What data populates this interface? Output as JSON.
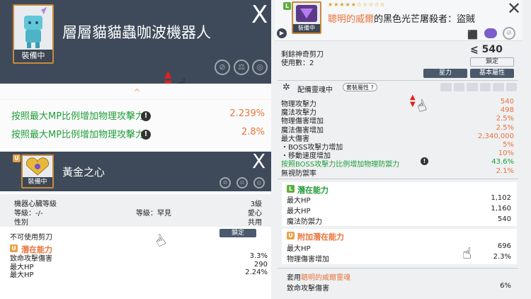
{
  "panel1": {
    "item_name": "層層貓貓蟲咖波機器人",
    "equip_tag": "裝備中",
    "close": "X",
    "stats": [
      {
        "label": "按照最大MP比例增加物理攻擊力",
        "value": "2.239%"
      },
      {
        "label": "按照最大MP比例增加物理攻擊力",
        "value": "2.8%"
      }
    ],
    "warn_glyph": "!"
  },
  "panel2": {
    "grade": "U",
    "item_name": "黃金之心",
    "equip_tag": "裝備中",
    "close": "X",
    "heart_level_label": "機器心臟等級",
    "heart_level_value": "3級",
    "level_label": "等級：-/-",
    "rank_label": "等級：罕見",
    "rank_value": "愛心",
    "gender_label": "性別",
    "gender_value": "共用",
    "scissors_label": "不可使用剪刀",
    "lock_button": "鎖定",
    "potential_title": "潛在能力",
    "potential": [
      {
        "label": "致命攻擊傷害",
        "value": "3.3%"
      },
      {
        "label": "最大HP",
        "value": "290"
      },
      {
        "label": "最大HP",
        "value": "2.24%"
      }
    ]
  },
  "panel3": {
    "grade": "L",
    "stars": "★★★★★☆☆☆☆☆",
    "star_count": 4,
    "title_prefix": "聰明的威爾",
    "title_suffix": "的黑色光芒屠殺者：盜賊",
    "equip_tag": "裝備中",
    "scissors_label": "剩餘神奇剪刀",
    "uses_label": "使用數：2",
    "scissors_value": "540",
    "lock_button": "鎖定",
    "star_button": "星力",
    "base_button": "基本屬性",
    "soul_label": "配備靈魂中",
    "set_button": "套裝屬性",
    "stats": [
      {
        "label": "物理攻擊力",
        "value": "540",
        "color": "#e8743b"
      },
      {
        "label": "魔法攻擊力",
        "value": "498",
        "color": "#e8743b"
      },
      {
        "label": "物理傷害增加",
        "value": "2.5%",
        "color": "#e8743b"
      },
      {
        "label": "魔法傷害增加",
        "value": "2.5%",
        "color": "#e8743b"
      },
      {
        "label": "最大傷害",
        "value": "2,340,000",
        "color": "#e8743b"
      },
      {
        "label": "・BOSS攻擊力增加",
        "value": "5%",
        "color": "#e8743b"
      },
      {
        "label": "・移動速度增加",
        "value": "10%",
        "color": "#e8743b"
      },
      {
        "label": "按照BOSS攻擊力比例增加物理防禦力",
        "value": "43.6%",
        "color": "#1f9d3a"
      },
      {
        "label": "無視防禦率",
        "value": "2.1%",
        "color": "#e8743b"
      }
    ],
    "potential_grade": "L",
    "potential_title": "潛在能力",
    "potential": [
      {
        "label": "最大HP",
        "value": "1,102"
      },
      {
        "label": "最大HP",
        "value": "1,160"
      },
      {
        "label": "魔法防禦力",
        "value": "540"
      }
    ],
    "additional_grade": "U",
    "additional_title": "附加潛在能力",
    "additional": [
      {
        "label": "最大HP",
        "value": "696"
      },
      {
        "label": "物理傷害增加",
        "value": "2.3%"
      }
    ],
    "soul_set_label": "套用",
    "soul_set_name": "聰明的威爾靈魂",
    "soul_effect_label": "致命攻擊傷害",
    "soul_effect_value": "6%"
  },
  "colors": {
    "header": "#3e4a5a",
    "orange": "#e8743b",
    "green": "#1f9d3a",
    "frame": "#c78a3a"
  }
}
